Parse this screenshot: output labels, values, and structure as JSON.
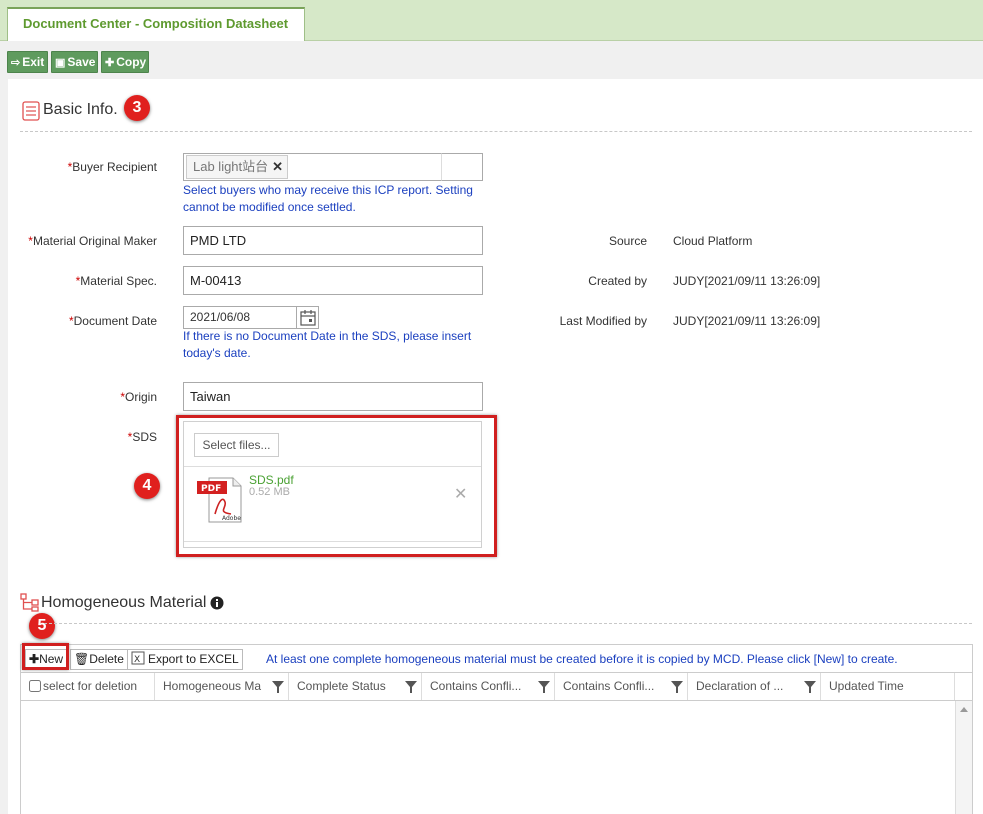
{
  "tab": {
    "title": "Document Center - Composition Datasheet"
  },
  "toolbar": {
    "exit": "Exit",
    "save": "Save",
    "copy": "Copy"
  },
  "basic": {
    "title": "Basic Info.",
    "badge": "3"
  },
  "form": {
    "buyer_label": "Buyer Recipient",
    "buyer_chip": "Lab light站台",
    "buyer_hint_1": "Select buyers who may receive this ICP report. Setting",
    "buyer_hint_2": "cannot be modified once settled.",
    "maker_label": "Material Original Maker",
    "maker_value": "PMD LTD",
    "spec_label": "Material Spec.",
    "spec_value": "M-00413",
    "date_label": "Document Date",
    "date_value": "2021/06/08",
    "date_hint_1": "If there is no Document Date in the SDS, please insert",
    "date_hint_2": "today's date.",
    "origin_label": "Origin",
    "origin_value": "Taiwan",
    "sds_label": "SDS",
    "select_files": "Select files...",
    "file_name": "SDS.pdf",
    "file_size": "0.52 MB",
    "sds_badge": "4",
    "req_mark": "*"
  },
  "meta": {
    "source_label": "Source",
    "source_value": "Cloud Platform",
    "created_label": "Created by",
    "created_value": "JUDY[2021/09/11 13:26:09]",
    "modified_label": "Last Modified by",
    "modified_value": "JUDY[2021/09/11 13:26:09]"
  },
  "homog": {
    "title": "Homogeneous Material",
    "badge": "5"
  },
  "grid": {
    "new": "New",
    "delete": "Delete",
    "export": "Export to EXCEL",
    "note": "At least one complete homogeneous material must be created before it is copied by MCD. Please click [New] to create.",
    "columns": [
      "select for deletion",
      "Homogeneous Ma",
      "Complete Status",
      "Contains Confli...",
      "Contains Confli...",
      "Declaration of ...",
      "Updated Time"
    ]
  },
  "icons": [
    "exit-icon",
    "save-icon",
    "plus-icon",
    "list-icon",
    "calendar-icon",
    "pdf-icon",
    "close-icon",
    "tree-icon",
    "info-icon",
    "trash-icon",
    "excel-icon",
    "filter-icon"
  ]
}
